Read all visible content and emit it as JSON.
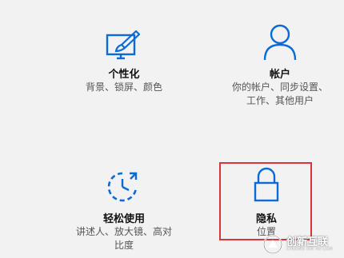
{
  "accent": "#0a6bd6",
  "highlight_color": "#d9343a",
  "tiles": {
    "personalization": {
      "icon": "paintbrush-monitor-icon",
      "title": "个性化",
      "desc_line1": "背景、锁屏、颜色"
    },
    "accounts": {
      "icon": "person-icon",
      "title": "帐户",
      "desc_line1": "你的帐户、同步设置、",
      "desc_line2": "工作、其他用户"
    },
    "ease_of_access": {
      "icon": "ease-of-access-icon",
      "title": "轻松使用",
      "desc_line1": "讲述人、放大镜、高对",
      "desc_line2": "比度"
    },
    "privacy": {
      "icon": "lock-icon",
      "title": "隐私",
      "desc_line1": "位置"
    }
  },
  "watermark": {
    "icon": "brand-logo-icon",
    "text_cn": "创新互联",
    "text_en": "CHUANG XIN HU LIAN"
  }
}
